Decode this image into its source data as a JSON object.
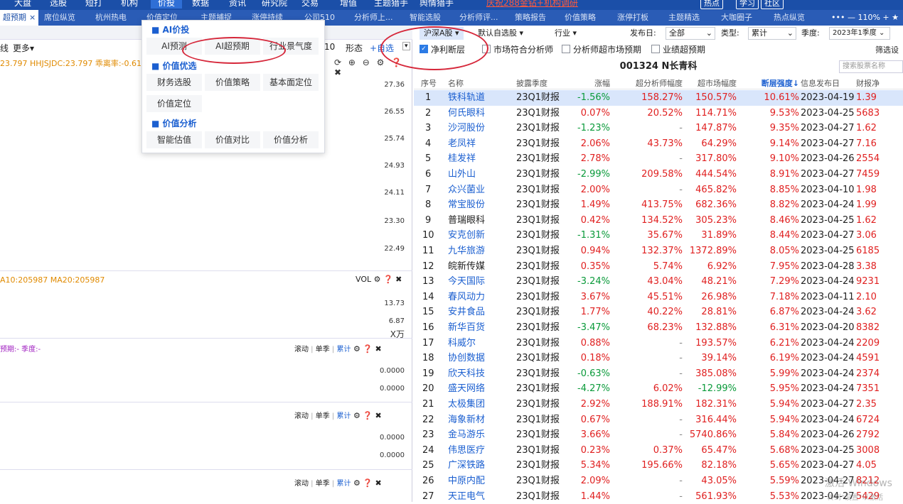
{
  "top_menu": [
    "大盘",
    "选股",
    "短打",
    "机构",
    "价投",
    "数据",
    "资讯",
    "研究院",
    "交易",
    "增值",
    "主题猎手",
    "舆情猎手"
  ],
  "top_promo": "庆祝288金钻+机构调研",
  "top_buttons": [
    "热点",
    "学习",
    "社区"
  ],
  "tabs": [
    "超预期",
    "席位纵览",
    "杭州热电",
    "价值定位",
    "主题捕捉",
    "涨停持续",
    "公司510",
    "分析师上...",
    "智能选股",
    "分析师评...",
    "策略报告",
    "价值策略",
    "涨停打板",
    "主题精选",
    "大咖圈子",
    "热点纵览"
  ],
  "tab_close": "×",
  "zoom": "110%",
  "window_controls": "••• —",
  "left": {
    "row1_left": "线",
    "more": "更多▾",
    "ma_line": "23.797  HHJSJDC:23.797  乖离率:-0.618",
    "period": "10",
    "form": "形态",
    "self_select": "+自选",
    "prices": [
      "27.36",
      "26.55",
      "25.74",
      "24.93",
      "24.11",
      "23.30",
      "22.49"
    ],
    "vol_label": "A10:205987  MA20:205987",
    "vol_tag": "VOL",
    "vol_values": [
      "13.73",
      "6.87",
      "X万"
    ],
    "ind_label": "预期:-  季度:-",
    "scroll_tabs": [
      "滚动",
      "单季",
      "累计"
    ],
    "zero": "0.0000"
  },
  "popup": {
    "sections": [
      {
        "title": "■ AI价投",
        "items": [
          "AI预测",
          "AI超预期",
          "行业景气度"
        ]
      },
      {
        "title": "■ 价值优选",
        "items": [
          "财务选股",
          "价值策略",
          "基本面定位",
          "价值定位"
        ]
      },
      {
        "title": "■ 价值分析",
        "items": [
          "智能估值",
          "价值对比",
          "价值分析"
        ]
      }
    ]
  },
  "filters": {
    "market": "沪深A股",
    "default_group": "默认自选股",
    "industry": "行业",
    "publish_label": "发布日:",
    "publish_value": "全部",
    "type_label": "类型:",
    "type_value": "累计",
    "season_label": "季度:",
    "season_value": "2023年1季度"
  },
  "checks": [
    {
      "label": "净利断层",
      "checked": true
    },
    {
      "label": "市场符合分析师",
      "checked": false
    },
    {
      "label": "分析师超市场预期",
      "checked": false
    },
    {
      "label": "业绩超预期",
      "checked": false
    }
  ],
  "filter_btn": "筛选设",
  "stock_title": "001324  N长青科",
  "search_placeholder": "搜索股票名称",
  "columns": [
    "序号",
    "名称",
    "披露季度",
    "涨幅",
    "超分析师幅度",
    "超市场幅度",
    "断层强度↓",
    "信息发布日",
    "财报净"
  ],
  "rows": [
    [
      "1",
      "铁科轨道",
      "23Q1财报",
      "-1.56%",
      "158.27%",
      "150.57%",
      "10.61%",
      "2023-04-19",
      "1.39"
    ],
    [
      "2",
      "何氏眼科",
      "23Q1财报",
      "0.07%",
      "20.52%",
      "114.71%",
      "9.53%",
      "2023-04-25",
      "5683"
    ],
    [
      "3",
      "沙河股份",
      "23Q1财报",
      "-1.23%",
      "-",
      "147.87%",
      "9.35%",
      "2023-04-27",
      "1.62"
    ],
    [
      "4",
      "老凤祥",
      "23Q1财报",
      "2.06%",
      "43.73%",
      "64.29%",
      "9.14%",
      "2023-04-27",
      "7.16"
    ],
    [
      "5",
      "桂发祥",
      "23Q1财报",
      "2.78%",
      "-",
      "317.80%",
      "9.10%",
      "2023-04-26",
      "2554"
    ],
    [
      "6",
      "山外山",
      "23Q1财报",
      "-2.99%",
      "209.58%",
      "444.54%",
      "8.91%",
      "2023-04-27",
      "7459"
    ],
    [
      "7",
      "众兴菌业",
      "23Q1财报",
      "2.00%",
      "-",
      "465.82%",
      "8.85%",
      "2023-04-10",
      "1.98"
    ],
    [
      "8",
      "常宝股份",
      "23Q1财报",
      "1.49%",
      "413.75%",
      "682.36%",
      "8.82%",
      "2023-04-24",
      "1.99"
    ],
    [
      "9",
      "普瑞眼科",
      "23Q1财报",
      "0.42%",
      "134.52%",
      "305.23%",
      "8.46%",
      "2023-04-25",
      "1.62"
    ],
    [
      "10",
      "安克创新",
      "23Q1财报",
      "-1.31%",
      "35.67%",
      "31.89%",
      "8.44%",
      "2023-04-27",
      "3.06"
    ],
    [
      "11",
      "九华旅游",
      "23Q1财报",
      "0.94%",
      "132.37%",
      "1372.89%",
      "8.05%",
      "2023-04-25",
      "6185"
    ],
    [
      "12",
      "皖新传媒",
      "23Q1财报",
      "0.35%",
      "5.74%",
      "6.92%",
      "7.95%",
      "2023-04-28",
      "3.38"
    ],
    [
      "13",
      "今天国际",
      "23Q1财报",
      "-3.24%",
      "43.04%",
      "48.21%",
      "7.29%",
      "2023-04-24",
      "9231"
    ],
    [
      "14",
      "春风动力",
      "23Q1财报",
      "3.67%",
      "45.51%",
      "26.98%",
      "7.18%",
      "2023-04-11",
      "2.10"
    ],
    [
      "15",
      "安井食品",
      "23Q1财报",
      "1.77%",
      "40.22%",
      "28.81%",
      "6.87%",
      "2023-04-24",
      "3.62"
    ],
    [
      "16",
      "新华百货",
      "23Q1财报",
      "-3.47%",
      "68.23%",
      "132.88%",
      "6.31%",
      "2023-04-20",
      "8382"
    ],
    [
      "17",
      "科威尔",
      "23Q1财报",
      "0.88%",
      "-",
      "193.57%",
      "6.21%",
      "2023-04-24",
      "2209"
    ],
    [
      "18",
      "协创数据",
      "23Q1财报",
      "0.18%",
      "-",
      "39.14%",
      "6.19%",
      "2023-04-24",
      "4591"
    ],
    [
      "19",
      "欣天科技",
      "23Q1财报",
      "-0.63%",
      "-",
      "385.08%",
      "5.99%",
      "2023-04-24",
      "2374"
    ],
    [
      "20",
      "盛天网络",
      "23Q1财报",
      "-4.27%",
      "6.02%",
      "-12.99%",
      "5.95%",
      "2023-04-24",
      "7351"
    ],
    [
      "21",
      "太极集团",
      "23Q1财报",
      "2.92%",
      "188.91%",
      "182.31%",
      "5.94%",
      "2023-04-27",
      "2.35"
    ],
    [
      "22",
      "海象新材",
      "23Q1财报",
      "0.67%",
      "-",
      "316.44%",
      "5.94%",
      "2023-04-24",
      "6724"
    ],
    [
      "23",
      "金马游乐",
      "23Q1财报",
      "3.66%",
      "-",
      "5740.86%",
      "5.84%",
      "2023-04-26",
      "2792"
    ],
    [
      "24",
      "伟思医疗",
      "23Q1财报",
      "0.23%",
      "0.37%",
      "65.47%",
      "5.68%",
      "2023-04-25",
      "3008"
    ],
    [
      "25",
      "广深铁路",
      "23Q1财报",
      "5.34%",
      "195.66%",
      "82.18%",
      "5.65%",
      "2023-04-27",
      "4.05"
    ],
    [
      "26",
      "中原内配",
      "23Q1财报",
      "2.09%",
      "-",
      "43.05%",
      "5.59%",
      "2023-04-27",
      "8212"
    ],
    [
      "27",
      "天正电气",
      "23Q1财报",
      "1.44%",
      "-",
      "561.93%",
      "5.53%",
      "2023-04-27",
      "5429"
    ]
  ],
  "watermark": [
    "激活 Windows",
    "转到\"设置\"以激活"
  ],
  "colors": {
    "up": "#e02020",
    "down": "#0a9a3a",
    "link": "#1b5fd0",
    "accent": "#1b4fa8",
    "circle": "#d6273a"
  }
}
